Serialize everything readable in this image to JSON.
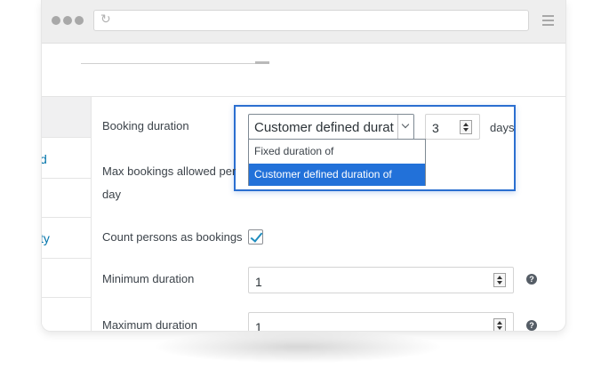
{
  "sidebar": {
    "items": [
      {
        "label": "d"
      },
      {
        "label": ""
      },
      {
        "label": "ty"
      },
      {
        "label": ""
      },
      {
        "label": ""
      }
    ]
  },
  "form": {
    "booking_duration": {
      "label": "Booking duration",
      "selected": "Customer defined durat",
      "options": [
        "Fixed duration of",
        "Customer defined duration of"
      ],
      "value": "3",
      "unit": "days"
    },
    "max_bookings": {
      "label_line1": "Max bookings allowed per",
      "label_line2": "day"
    },
    "count_persons": {
      "label": "Count persons as bookings",
      "checked": true
    },
    "minimum_duration": {
      "label": "Minimum duration",
      "value": "1",
      "help": "?"
    },
    "maximum_duration": {
      "label": "Maximum duration",
      "value": "1",
      "help": "?"
    }
  },
  "browser": {
    "reload_icon": "reload-icon",
    "menu_icon": "hamburger-menu-icon"
  },
  "colors": {
    "accent": "#2271d9",
    "highlight_border": "#2b6fd0",
    "link": "#0073aa"
  }
}
